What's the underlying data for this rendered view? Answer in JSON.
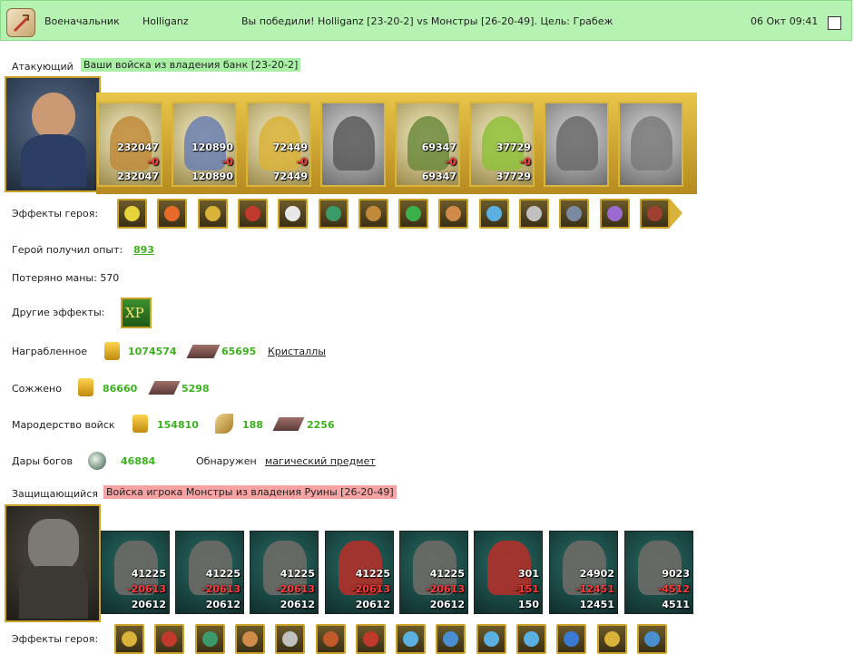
{
  "header": {
    "role": "Военачальник",
    "player": "Holliganz",
    "message": "Вы победили! Holliganz [23-20-2] vs Монстры [26-20-49]. Цель: Грабеж",
    "datetime": "06 Окт 09:41"
  },
  "attacker": {
    "label": "Атакующий",
    "army": "Ваши войска из владения банк [23-20-2]",
    "units": [
      {
        "top": "232047",
        "mid": "-0",
        "bottom": "232047"
      },
      {
        "top": "120890",
        "mid": "-0",
        "bottom": "120890"
      },
      {
        "top": "72449",
        "mid": "-0",
        "bottom": "72449"
      },
      {
        "top": "",
        "mid": "",
        "bottom": ""
      },
      {
        "top": "69347",
        "mid": "-0",
        "bottom": "69347"
      },
      {
        "top": "37729",
        "mid": "-0",
        "bottom": "37729"
      },
      {
        "top": "",
        "mid": "",
        "bottom": ""
      },
      {
        "top": "",
        "mid": "",
        "bottom": ""
      }
    ],
    "effects_label": "Эффекты героя:",
    "exp_label": "Герой получил опыт:",
    "exp_value": "893",
    "mana_label": "Потеряно маны: 570",
    "other_effects_label": "Другие эффекты:",
    "xp_badge": "XP"
  },
  "rewards": {
    "awarded_label": "Награбленное",
    "awarded_gold": "1074574",
    "awarded_ore": "65695",
    "awarded_link": "Кристаллы",
    "burned_label": "Сожжено",
    "burned_gold": "86660",
    "burned_ore": "5298",
    "looting_label": "Мародерство войск",
    "looting_gold": "154810",
    "looting_wheat": "188",
    "looting_ore": "2256",
    "gods_label": "Дары богов",
    "gods_value": "46884",
    "found_label": "Обнаружен",
    "found_link": "магический предмет"
  },
  "defender": {
    "label": "Защищающийся",
    "army": "Войска игрока Монстры из владения Руины [26-20-49]",
    "units": [
      {
        "top": "41225",
        "mid": "-20613",
        "bottom": "20612"
      },
      {
        "top": "41225",
        "mid": "-20613",
        "bottom": "20612"
      },
      {
        "top": "41225",
        "mid": "-20613",
        "bottom": "20612"
      },
      {
        "top": "41225",
        "mid": "-20613",
        "bottom": "20612"
      },
      {
        "top": "41225",
        "mid": "-20613",
        "bottom": "20612"
      },
      {
        "top": "301",
        "mid": "-151",
        "bottom": "150"
      },
      {
        "top": "24902",
        "mid": "-12451",
        "bottom": "12451"
      },
      {
        "top": "9023",
        "mid": "-4512",
        "bottom": "4511"
      }
    ],
    "effects_label": "Эффекты героя:"
  },
  "colors": {
    "header_bg": "#b6f2b1",
    "attacker_tag": "#a9f0a6",
    "defender_tag": "#f7a3a3",
    "value_green": "#3cb31d"
  }
}
